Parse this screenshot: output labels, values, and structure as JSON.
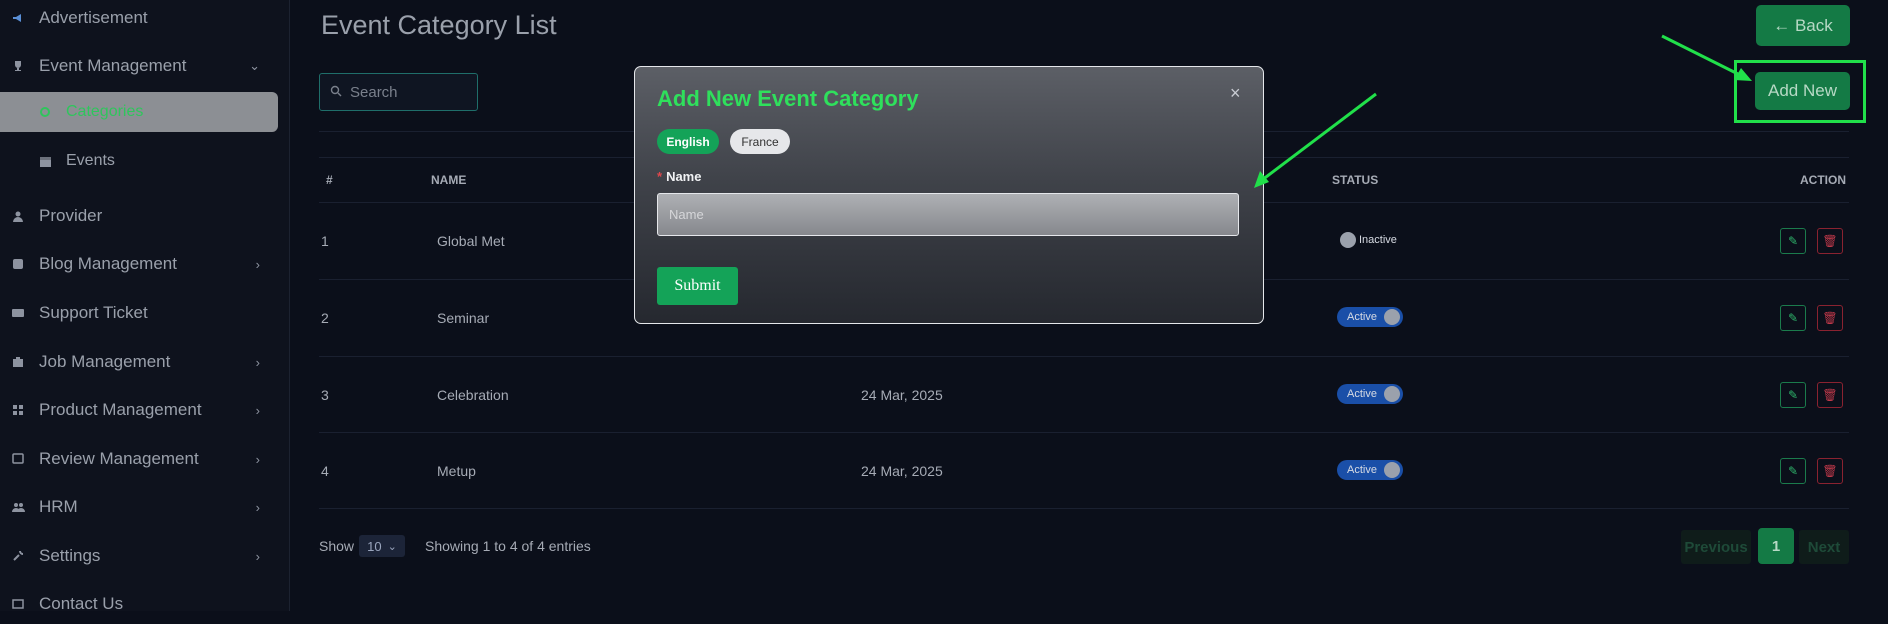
{
  "sidebar": {
    "items": [
      {
        "label": "Advertisement",
        "icon": "megaphone-icon",
        "has_chevron": false
      },
      {
        "label": "Event Management",
        "icon": "trophy-icon",
        "has_chevron": true,
        "expanded": true
      },
      {
        "label": "Provider",
        "icon": "user-icon",
        "has_chevron": false
      },
      {
        "label": "Blog Management",
        "icon": "blog-icon",
        "has_chevron": true
      },
      {
        "label": "Support Ticket",
        "icon": "ticket-icon",
        "has_chevron": false
      },
      {
        "label": "Job Management",
        "icon": "briefcase-icon",
        "has_chevron": true
      },
      {
        "label": "Product Management",
        "icon": "grid-icon",
        "has_chevron": true
      },
      {
        "label": "Review Management",
        "icon": "review-icon",
        "has_chevron": true
      },
      {
        "label": "HRM",
        "icon": "people-icon",
        "has_chevron": true
      },
      {
        "label": "Settings",
        "icon": "wrench-icon",
        "has_chevron": true
      },
      {
        "label": "Contact Us",
        "icon": "contact-icon",
        "has_chevron": false
      }
    ],
    "subitems": [
      {
        "label": "Categories",
        "icon": "category-icon",
        "active": true
      },
      {
        "label": "Events",
        "icon": "calendar-icon",
        "active": false
      }
    ]
  },
  "page": {
    "title": "Event Category List",
    "back_label": "← Back",
    "add_label": "Add New",
    "search_placeholder": "Search"
  },
  "table": {
    "headers": [
      "#",
      "NAME",
      "STATUS",
      "ACTION"
    ],
    "rows": [
      {
        "no": "1",
        "name": "Global Met",
        "date": "",
        "status": "Inactive",
        "active": false
      },
      {
        "no": "2",
        "name": "Seminar",
        "date": "",
        "status": "Active",
        "active": true
      },
      {
        "no": "3",
        "name": "Celebration",
        "date": "24 Mar, 2025",
        "status": "Active",
        "active": true
      },
      {
        "no": "4",
        "name": "Metup",
        "date": "24 Mar, 2025",
        "status": "Active",
        "active": true
      }
    ]
  },
  "footer": {
    "show_label": "Show",
    "page_size": "10",
    "entries_text": "Showing 1 to 4 of 4 entries",
    "prev_label": "Previous",
    "current_page": "1",
    "next_label": "Next"
  },
  "modal": {
    "title": "Add New Event Category",
    "lang_tabs": [
      "English",
      "France"
    ],
    "required_mark": "*",
    "name_label": "Name",
    "name_placeholder": "Name",
    "submit_label": "Submit",
    "close_glyph": "×"
  },
  "colors": {
    "accent_green": "#2fe05c",
    "button_green": "#147a45",
    "toggle_blue": "#1a4fa8",
    "annotation_green": "#21e04a"
  }
}
